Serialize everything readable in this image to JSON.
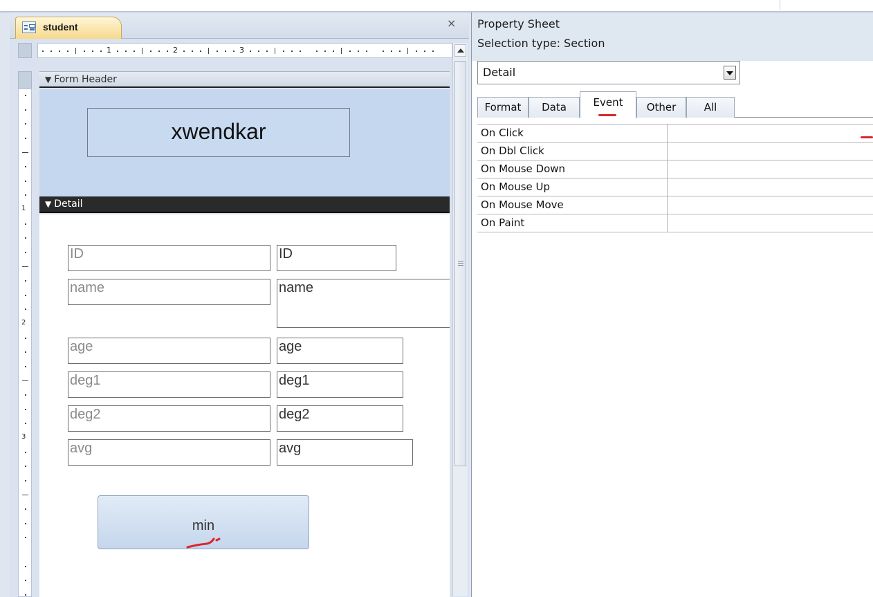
{
  "window": {
    "tab_label": "student",
    "close_glyph": "×"
  },
  "ruler": {
    "marks": [
      "1",
      "2",
      "3"
    ],
    "vertical_marks": [
      "1",
      "2",
      "3"
    ]
  },
  "form": {
    "header_section_label": "Form Header",
    "detail_section_label": "Detail",
    "section_arrow": "▼",
    "title": "xwendkar",
    "fields": [
      {
        "label": "ID",
        "control": "ID"
      },
      {
        "label": "name",
        "control": "name"
      },
      {
        "label": "age",
        "control": "age"
      },
      {
        "label": "deg1",
        "control": "deg1"
      },
      {
        "label": "deg2",
        "control": "deg2"
      },
      {
        "label": "avg",
        "control": "avg"
      }
    ],
    "button_label": "min"
  },
  "property_sheet": {
    "title": "Property Sheet",
    "selection_type": "Selection type:  Section",
    "selected_object": "Detail",
    "tabs": [
      "Format",
      "Data",
      "Event",
      "Other",
      "All"
    ],
    "active_tab": "Event",
    "properties": [
      {
        "name": "On Click",
        "value": ""
      },
      {
        "name": "On Dbl Click",
        "value": ""
      },
      {
        "name": "On Mouse Down",
        "value": ""
      },
      {
        "name": "On Mouse Up",
        "value": ""
      },
      {
        "name": "On Mouse Move",
        "value": ""
      },
      {
        "name": "On Paint",
        "value": ""
      }
    ]
  },
  "icons": {
    "tab_icon": "form-icon",
    "close": "close-icon",
    "dropdown": "chevron-down-icon",
    "scroll_up": "arrow-up-icon"
  },
  "colors": {
    "header_band": "#c5d7ee",
    "detail_bar": "#2a2a2a",
    "annotation": "#d9262b"
  }
}
